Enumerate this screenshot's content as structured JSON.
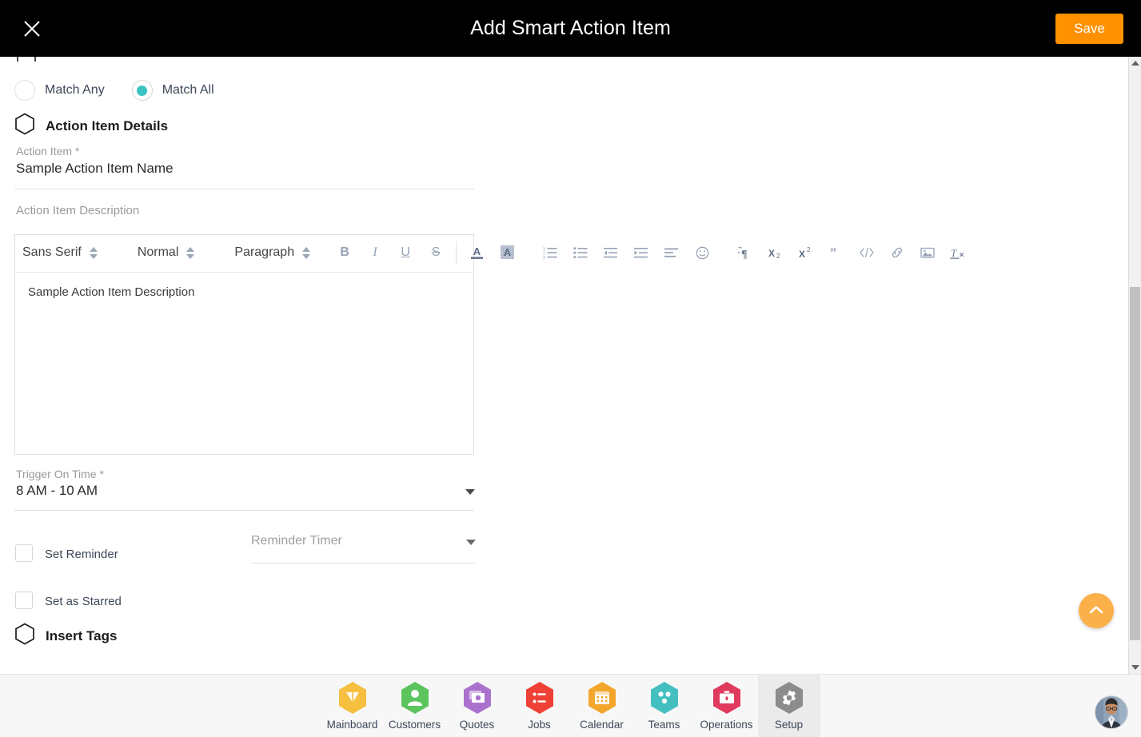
{
  "topbar": {
    "close_icon": "close-icon",
    "title": "Add Smart Action Item",
    "save_label": "Save"
  },
  "match_mode": {
    "options": [
      {
        "label": "Match Any",
        "selected": false
      },
      {
        "label": "Match All",
        "selected": true
      }
    ],
    "selected_color": "#3bc2c2"
  },
  "sections": {
    "action_item_details": "Action Item Details",
    "insert_tags": "Insert Tags"
  },
  "action_item": {
    "label": "Action Item *",
    "value": "Sample Action Item Name"
  },
  "description": {
    "label": "Action Item Description",
    "value": "Sample Action Item Description"
  },
  "editor_toolbar": {
    "font_family": "Sans Serif",
    "font_size": "Normal",
    "block_format": "Paragraph",
    "buttons": [
      {
        "name": "bold-icon",
        "glyph": "B"
      },
      {
        "name": "italic-icon",
        "glyph": "I"
      },
      {
        "name": "underline-icon",
        "glyph": "U"
      },
      {
        "name": "strikethrough-icon",
        "glyph": "S"
      },
      {
        "name": "font-color-icon",
        "glyph": "A"
      },
      {
        "name": "background-color-icon",
        "glyph": "A"
      },
      {
        "name": "ordered-list-icon",
        "glyph": ""
      },
      {
        "name": "bullet-list-icon",
        "glyph": ""
      },
      {
        "name": "outdent-icon",
        "glyph": ""
      },
      {
        "name": "indent-icon",
        "glyph": ""
      },
      {
        "name": "align-icon",
        "glyph": ""
      },
      {
        "name": "emoji-icon",
        "glyph": ""
      },
      {
        "name": "text-direction-icon",
        "glyph": ""
      },
      {
        "name": "subscript-icon",
        "glyph": "X"
      },
      {
        "name": "superscript-icon",
        "glyph": "X"
      },
      {
        "name": "blockquote-icon",
        "glyph": ""
      },
      {
        "name": "code-block-icon",
        "glyph": ""
      },
      {
        "name": "link-icon",
        "glyph": ""
      },
      {
        "name": "image-icon",
        "glyph": ""
      },
      {
        "name": "clear-format-icon",
        "glyph": ""
      }
    ]
  },
  "trigger_on_time": {
    "label": "Trigger On Time *",
    "value": "8 AM - 10 AM"
  },
  "set_reminder": {
    "label": "Set Reminder",
    "checked": false
  },
  "reminder_timer": {
    "placeholder": "Reminder Timer",
    "value": ""
  },
  "set_as_starred": {
    "label": "Set as Starred",
    "checked": false
  },
  "scroll_top_button": {
    "name": "scroll-to-top-icon"
  },
  "bottom_nav": {
    "items": [
      {
        "label": "Mainboard",
        "icon": "mainboard-icon",
        "color": "#f6bf3f",
        "active": false
      },
      {
        "label": "Customers",
        "icon": "customers-icon",
        "color": "#5cc45c",
        "active": false
      },
      {
        "label": "Quotes",
        "icon": "quotes-icon",
        "color": "#ab72cd",
        "active": false
      },
      {
        "label": "Jobs",
        "icon": "jobs-icon",
        "color": "#ef4036",
        "active": false
      },
      {
        "label": "Calendar",
        "icon": "calendar-icon",
        "color": "#f2a72c",
        "active": false
      },
      {
        "label": "Teams",
        "icon": "teams-icon",
        "color": "#44bfc0",
        "active": false
      },
      {
        "label": "Operations",
        "icon": "operations-icon",
        "color": "#e03a5f",
        "active": false
      },
      {
        "label": "Setup",
        "icon": "setup-icon",
        "color": "#8c8c8c",
        "active": true
      }
    ],
    "avatar": "user-avatar"
  }
}
